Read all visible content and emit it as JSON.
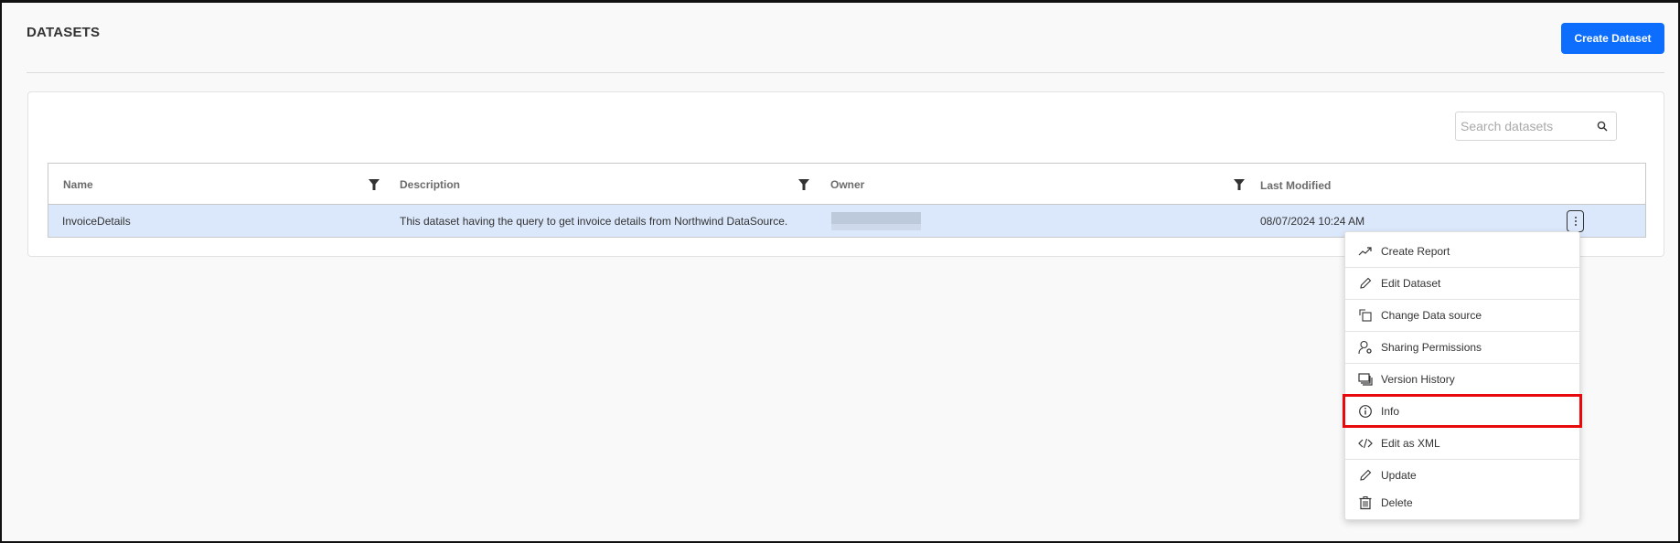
{
  "header": {
    "title": "DATASETS",
    "create_button_label": "Create Dataset"
  },
  "search": {
    "placeholder": "Search datasets",
    "value": ""
  },
  "grid": {
    "columns": [
      {
        "label": "Name",
        "filterable": true
      },
      {
        "label": "Description",
        "filterable": true
      },
      {
        "label": "Owner",
        "filterable": true
      },
      {
        "label": "Last Modified",
        "filterable": false
      }
    ],
    "rows": [
      {
        "name": "InvoiceDetails",
        "description": "This dataset having the query to get invoice details from Northwind DataSource.",
        "owner": "",
        "owner_redacted": true,
        "last_modified": "08/07/2024 10:24 AM",
        "selected": true
      }
    ]
  },
  "context_menu": {
    "items": [
      {
        "label": "Create Report",
        "icon": "trending-up-icon"
      },
      {
        "label": "Edit Dataset",
        "icon": "pencil-icon"
      },
      {
        "label": "Change Data source",
        "icon": "copy-icon"
      },
      {
        "label": "Sharing Permissions",
        "icon": "user-gear-icon"
      },
      {
        "label": "Version History",
        "icon": "versions-icon"
      },
      {
        "label": "Info",
        "icon": "info-icon",
        "highlighted": true
      },
      {
        "label": "Edit as XML",
        "icon": "code-icon"
      },
      {
        "label": "Update",
        "icon": "pencil-icon"
      },
      {
        "label": "Delete",
        "icon": "trash-icon"
      }
    ]
  },
  "colors": {
    "primary": "#0d6efd",
    "selected_row": "#dbe8fb",
    "highlight": "#e8090c",
    "background": "#f9f9f9"
  }
}
